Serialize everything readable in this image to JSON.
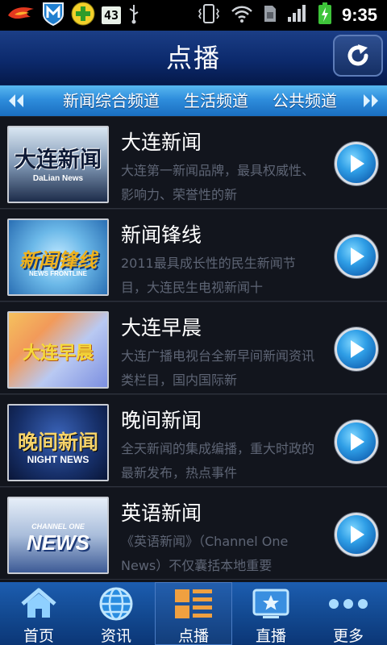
{
  "status_bar": {
    "battery_box_text": "43",
    "time": "9:35"
  },
  "header": {
    "title": "点播"
  },
  "channel_tabs": [
    "新闻综合频道",
    "生活频道",
    "公共频道"
  ],
  "programs": [
    {
      "title": "大连新闻",
      "desc": "大连第一新闻品牌，最具权威性、影响力、荣誉性的新",
      "thumb_text": "大连新闻",
      "thumb_sub": "DaLian News"
    },
    {
      "title": "新闻锋线",
      "desc": "2011最具成长性的民生新闻节目，大连民生电视新闻十",
      "thumb_text": "新闻锋线",
      "thumb_sub": "NEWS FRONTLINE"
    },
    {
      "title": "大连早晨",
      "desc": "大连广播电视台全新早间新闻资讯类栏目，国内国际新",
      "thumb_text": "大连早晨",
      "thumb_sub": ""
    },
    {
      "title": "晚间新闻",
      "desc": "全天新闻的集成编播，重大时政的最新发布，热点事件",
      "thumb_text": "晚间新闻",
      "thumb_sub": "NIGHT NEWS"
    },
    {
      "title": "英语新闻",
      "desc": "《英语新闻》（Channel One News）不仅囊括本地重要",
      "thumb_text": "NEWS",
      "thumb_sub": "CHANNEL ONE"
    }
  ],
  "bottom_nav": [
    {
      "label": "首页",
      "icon": "home-icon"
    },
    {
      "label": "资讯",
      "icon": "globe-icon"
    },
    {
      "label": "点播",
      "icon": "list-icon"
    },
    {
      "label": "直播",
      "icon": "tv-star-icon"
    },
    {
      "label": "更多",
      "icon": "more-icon"
    }
  ],
  "colors": {
    "header": "#0c2a6d",
    "tabbar": "#2e8ddc",
    "list_bg": "#12151d",
    "desc_text": "#5e6575",
    "nav_bg": "#134a92"
  }
}
